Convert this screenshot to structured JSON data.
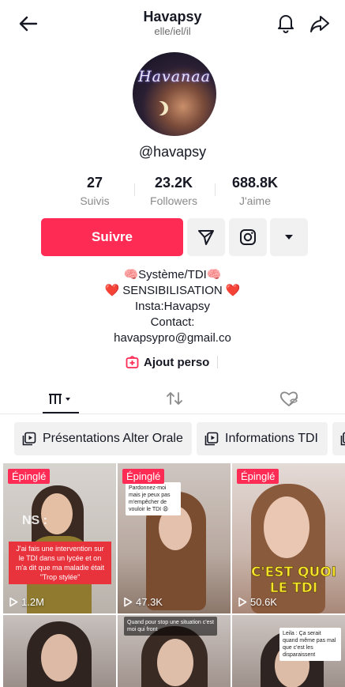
{
  "header": {
    "title": "Havapsy",
    "subtitle": "elle/iel/il"
  },
  "profile": {
    "avatar_text": "Havanaa",
    "handle": "@havapsy"
  },
  "stats": [
    {
      "value": "27",
      "label": "Suivis"
    },
    {
      "value": "23.2K",
      "label": "Followers"
    },
    {
      "value": "688.8K",
      "label": "J'aime"
    }
  ],
  "actions": {
    "follow_label": "Suivre"
  },
  "bio": {
    "line1": "🧠Système/TDI🧠",
    "line2": "❤️ SENSIBILISATION ❤️",
    "line3": "Insta:Havapsy",
    "line4": "Contact:",
    "line5": "havapsypro@gmail.co"
  },
  "perso": {
    "label": "Ajout perso"
  },
  "playlists": [
    {
      "label": "Présentations Alter Orale"
    },
    {
      "label": "Informations TDI"
    }
  ],
  "videos": [
    {
      "pinned": "Épinglé",
      "views": "1.2M",
      "caption": "J'ai fais une intervention sur le TDI dans un lycée et on m'a dit que ma maladie était \"Trop stylée\"",
      "overlay_text": "NS :"
    },
    {
      "pinned": "Épinglé",
      "views": "47.3K",
      "caption": "Pardonnez-moi mais je peux pas m'empêcher de vouloir le TDI 😩"
    },
    {
      "pinned": "Épinglé",
      "views": "50.6K",
      "caption": "C'EST QUOI LE TDI"
    },
    {
      "caption": ""
    },
    {
      "caption": "Quand pour stop une situation c'est moi qui front"
    },
    {
      "caption": "Leila : Ça serait quand même pas mal que c'est les disparaissent"
    }
  ],
  "colors": {
    "accent": "#fe2c55",
    "button_bg": "#f1f1f2",
    "text_primary": "#161823",
    "text_secondary": "#8a8a8a"
  }
}
